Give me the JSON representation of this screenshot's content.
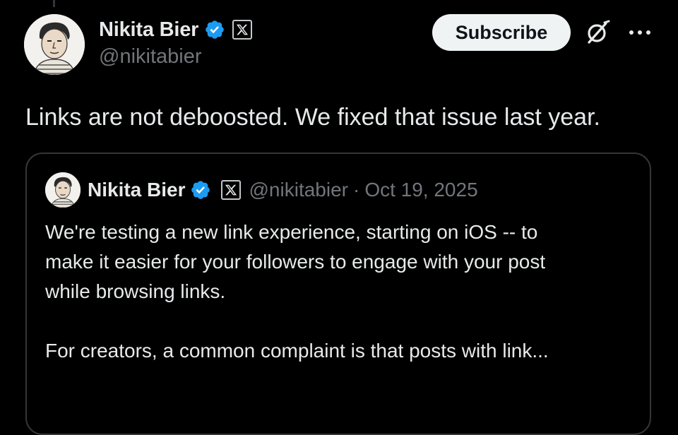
{
  "post": {
    "author": {
      "display_name": "Nikita Bier",
      "handle": "@nikitabier",
      "verified": true,
      "affiliation": "X"
    },
    "actions": {
      "subscribe_label": "Subscribe",
      "grok_icon": "grok-icon",
      "more_icon": "more-dots-icon"
    },
    "text": "Links are not deboosted. We fixed that issue last year."
  },
  "quoted_post": {
    "author": {
      "display_name": "Nikita Bier",
      "handle": "@nikitabier",
      "verified": true,
      "affiliation": "X"
    },
    "separator": "·",
    "date": "Oct 19, 2025",
    "body_lines": [
      "We're testing a new link experience, starting on iOS -- to",
      "make it easier for your followers to engage with your post",
      "while browsing links."
    ],
    "body_para2": "For creators, a common complaint is that posts with link..."
  },
  "colors": {
    "background": "#000000",
    "text_primary": "#e7e9ea",
    "text_secondary": "#71767b",
    "verified_blue": "#1d9bf0",
    "border": "#333639",
    "button_bg": "#eff3f4"
  }
}
